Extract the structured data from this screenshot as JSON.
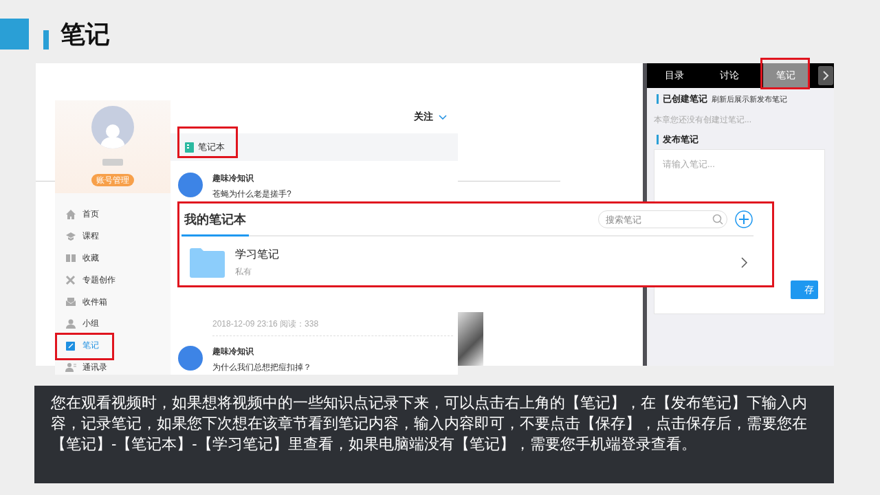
{
  "header": {
    "title": "笔记"
  },
  "sidebar": {
    "account_button": "账号管理",
    "items": [
      {
        "kind": "home",
        "label": "首页",
        "selected": false
      },
      {
        "kind": "course",
        "label": "课程",
        "selected": false
      },
      {
        "kind": "favorites",
        "label": "收藏",
        "selected": false
      },
      {
        "kind": "creation",
        "label": "专题创作",
        "selected": false
      },
      {
        "kind": "inbox",
        "label": "收件箱",
        "selected": false
      },
      {
        "kind": "group",
        "label": "小组",
        "selected": false
      },
      {
        "kind": "notes",
        "label": "笔记",
        "selected": true
      },
      {
        "kind": "contacts",
        "label": "通讯录",
        "selected": false
      }
    ]
  },
  "feed": {
    "follow_menu": "关注",
    "notebook_tab": "笔记本",
    "posts": [
      {
        "author": "趣味冷知识",
        "title": "苍蝇为什么老是搓手?",
        "meta": "2018-12-09 23:16 阅读：338"
      },
      {
        "author": "趣味冷知识",
        "title": "为什么我们总想把痘扣掉？"
      }
    ]
  },
  "notes_panel": {
    "tabs": [
      {
        "label": "目录",
        "selected": false
      },
      {
        "label": "讨论",
        "selected": false
      },
      {
        "label": "笔记",
        "selected": true
      }
    ],
    "created_heading": "已创建笔记",
    "refresh_hint": "刷新后展示新发布笔记",
    "empty_text": "本章您还没有创建过笔记...",
    "publish_heading": "发布笔记",
    "note_input": {
      "placeholder": "请输入笔记..."
    },
    "save_button": "存"
  },
  "notebook_popup": {
    "title": "我的笔记本",
    "search": {
      "placeholder": "搜索笔记"
    },
    "notebooks": [
      {
        "name": "学习笔记",
        "visibility": "私有"
      }
    ]
  },
  "caption": "您在观看视频时，如果想将视频中的一些知识点记录下来，可以点击右上角的【笔记】，在【发布笔记】下输入内容，记录笔记，如果您下次想在该章节看到笔记内容，输入内容即可，不要点击【保存】，点击保存后，需要您在【笔记】-【笔记本】-【学习笔记】里查看，如果电脑端没有【笔记】，需要您手机端登录查看。"
}
